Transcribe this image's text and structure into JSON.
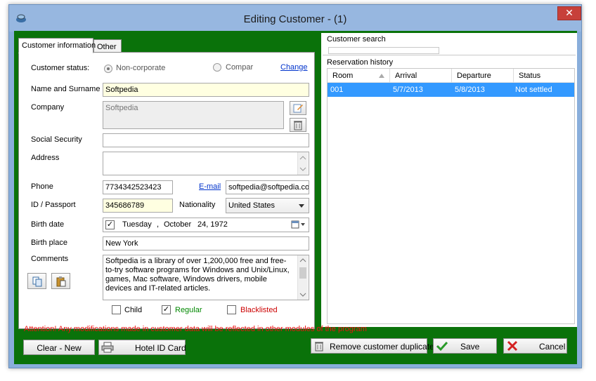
{
  "window": {
    "title": "Editing Customer - (1)",
    "close_glyph": "✕"
  },
  "tabs": {
    "customer_info": "Customer information",
    "other": "Other"
  },
  "form": {
    "customer_status_label": "Customer status:",
    "radio_noncorporate": "Non-corporate",
    "radio_company": "Compar",
    "change_link": "Change",
    "name_label": "Name and Surname",
    "name_value": "Softpedia",
    "company_label": "Company",
    "company_value": "Softpedia",
    "ssn_label": "Social Security",
    "ssn_value": "",
    "address_label": "Address",
    "address_value": "",
    "phone_label": "Phone",
    "phone_value": "7734342523423",
    "email_link": "E-mail",
    "email_value": "softpedia@softpedia.co",
    "id_label": "ID / Passport",
    "id_value": "345686789",
    "nationality_label": "Nationality",
    "nationality_value": "United States",
    "birthdate_label": "Birth date",
    "birthdate_day": "Tuesday",
    "birthdate_sep": ",",
    "birthdate_month": "October",
    "birthdate_date": "24, 1972",
    "birthplace_label": "Birth place",
    "birthplace_value": "New York",
    "comments_label": "Comments",
    "comments_value": "Softpedia is a library of over 1,200,000 free and free-to-try software programs for Windows and Unix/Linux, games, Mac software, Windows drivers, mobile devices and IT-related articles.",
    "child_label": "Child",
    "regular_label": "Regular",
    "blacklisted_label": "Blacklisted",
    "child_checked": false,
    "regular_checked": true,
    "blacklisted_checked": false
  },
  "right": {
    "search_label": "Customer search",
    "history_label": "Reservation history",
    "columns": [
      "Room",
      "Arrival",
      "Departure",
      "Status"
    ],
    "rows": [
      [
        "001",
        "5/7/2013",
        "5/8/2013",
        "Not settled"
      ]
    ]
  },
  "footer": {
    "warning": "Attention! Any modifications made in customer data will be reflected in other modules of the program",
    "clear_new": "Clear - New",
    "hotel_id_card": "Hotel ID Card",
    "remove_duplicate": "Remove customer duplicate",
    "save": "Save",
    "cancel": "Cancel"
  },
  "colors": {
    "client_bg": "#0a720a",
    "selection": "#3399ff",
    "warning": "#ee1111",
    "regular_text": "#008800",
    "blacklisted_text": "#cc0000"
  }
}
